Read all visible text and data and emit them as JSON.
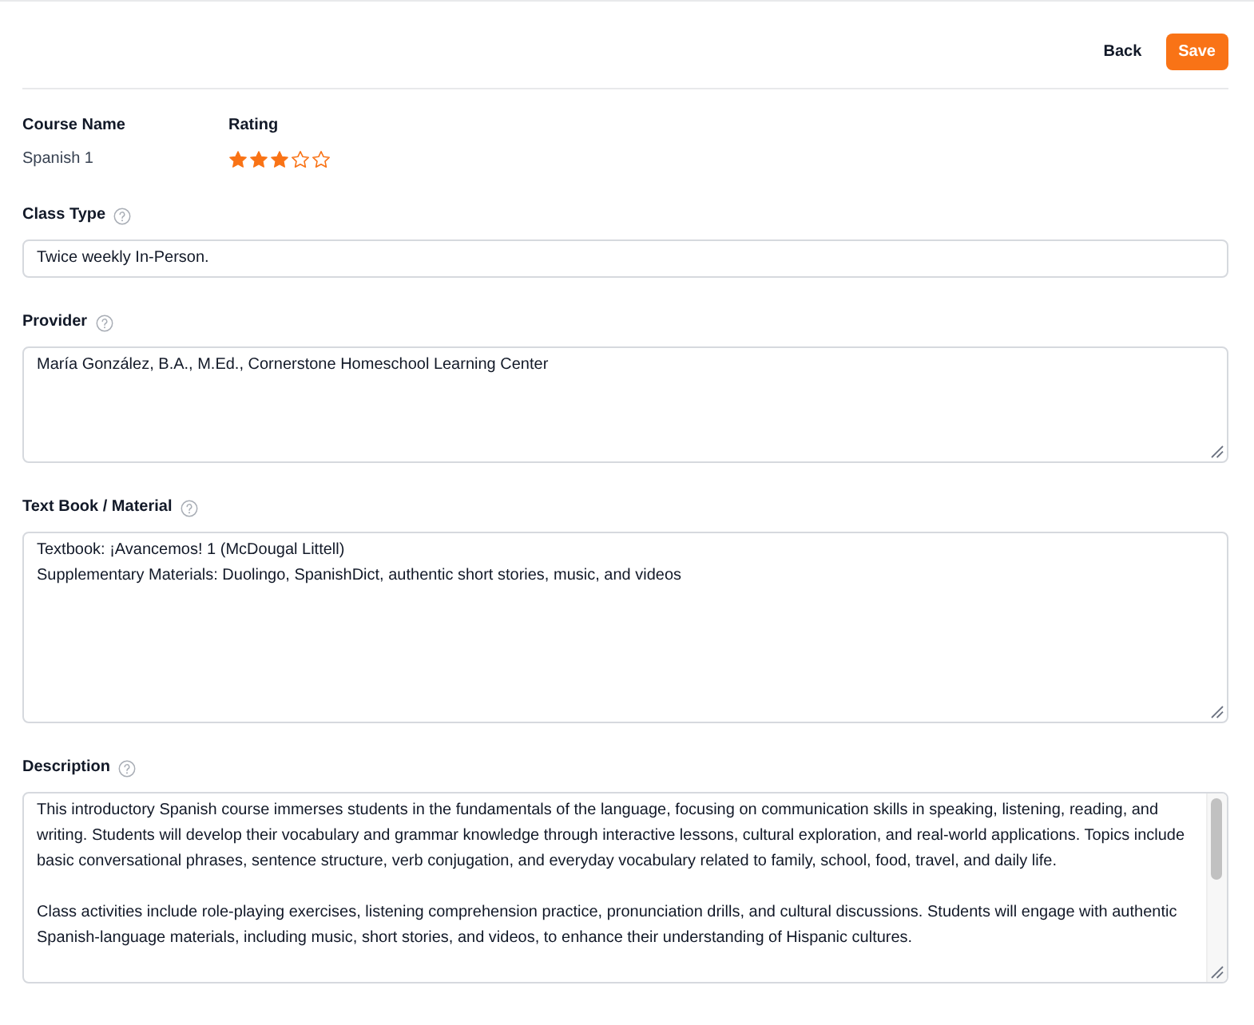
{
  "header": {
    "buttons": [
      {
        "label": "Back",
        "kind": "text"
      },
      {
        "label": "Save",
        "kind": "primary"
      }
    ]
  },
  "summary": [
    {
      "kind": "text",
      "label": "Course Name",
      "value": "Spanish 1"
    },
    {
      "kind": "rating",
      "label": "Rating",
      "stars": 3
    }
  ],
  "fields": [
    {
      "kind": "input",
      "label": "Class Type",
      "help": true,
      "value": "Twice weekly In-Person."
    },
    {
      "kind": "textarea",
      "label": "Provider",
      "help": true,
      "value": "María González, B.A., M.Ed., Cornerstone Homeschool Learning Center",
      "scrollable": false
    },
    {
      "kind": "textarea",
      "label": "Text Book / Material",
      "help": true,
      "value": "Textbook: ¡Avancemos! 1 (McDougal Littell)\nSupplementary Materials: Duolingo, SpanishDict, authentic short stories, music, and videos",
      "scrollable": false
    },
    {
      "kind": "textarea",
      "label": "Description",
      "help": true,
      "value": "This introductory Spanish course immerses students in the fundamentals of the language, focusing on communication skills in speaking, listening, reading, and writing. Students will develop their vocabulary and grammar knowledge through interactive lessons, cultural exploration, and real-world applications. Topics include basic conversational phrases, sentence structure, verb conjugation, and everyday vocabulary related to family, school, food, travel, and daily life.\n\nClass activities include role-playing exercises, listening comprehension practice, pronunciation drills, and cultural discussions. Students will engage with authentic Spanish-language materials, including music, short stories, and videos, to enhance their understanding of Hispanic cultures.",
      "scrollable": true
    }
  ]
}
